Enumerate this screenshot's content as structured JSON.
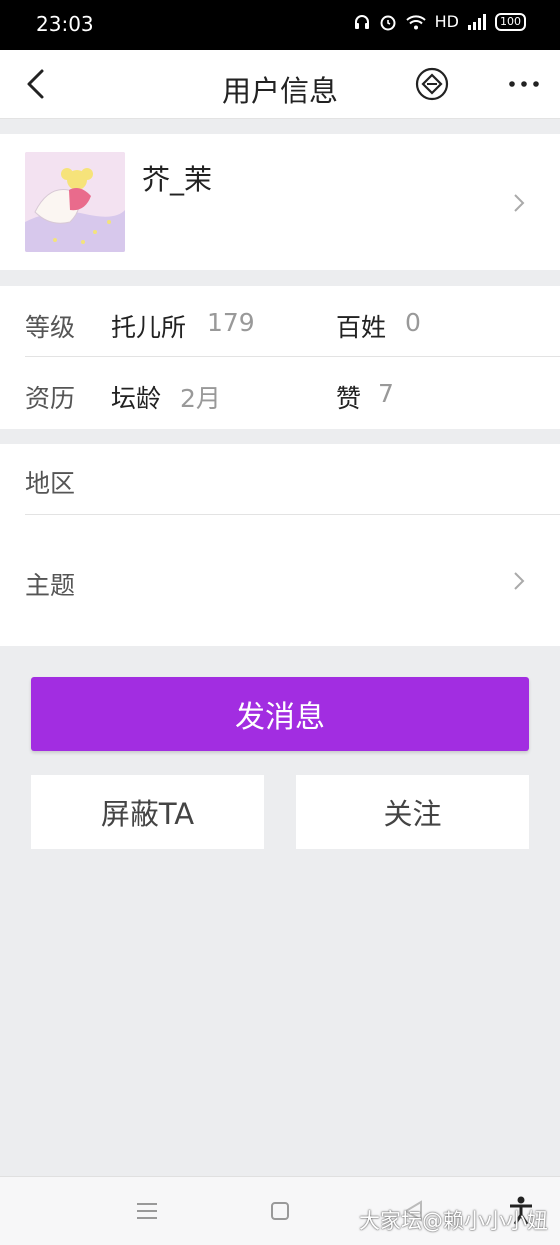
{
  "status_bar": {
    "time": "23:03",
    "network": "HD",
    "battery": "100",
    "icons": [
      "headphones-icon",
      "alarm-icon",
      "wifi-icon",
      "signal-icon",
      "battery-icon"
    ]
  },
  "header": {
    "title": "用户信息",
    "icons": [
      "back-arrow-icon",
      "diamond-icon",
      "more-icon"
    ]
  },
  "profile": {
    "username": "芥_茉"
  },
  "stats": {
    "level_label": "等级",
    "level_name": "托儿所",
    "level_value": "179",
    "rank_name": "百姓",
    "rank_value": "0",
    "history_label": "资历",
    "age_name": "坛龄",
    "age_value": "2月",
    "likes_name": "赞",
    "likes_value": "7"
  },
  "info": {
    "region_label": "地区",
    "topics_label": "主题"
  },
  "actions": {
    "send_message": "发消息",
    "block": "屏蔽TA",
    "follow": "关注"
  },
  "watermark": "大家坛@赖小小小妞",
  "colors": {
    "primary": "#a22de1",
    "background": "#ecedef"
  }
}
